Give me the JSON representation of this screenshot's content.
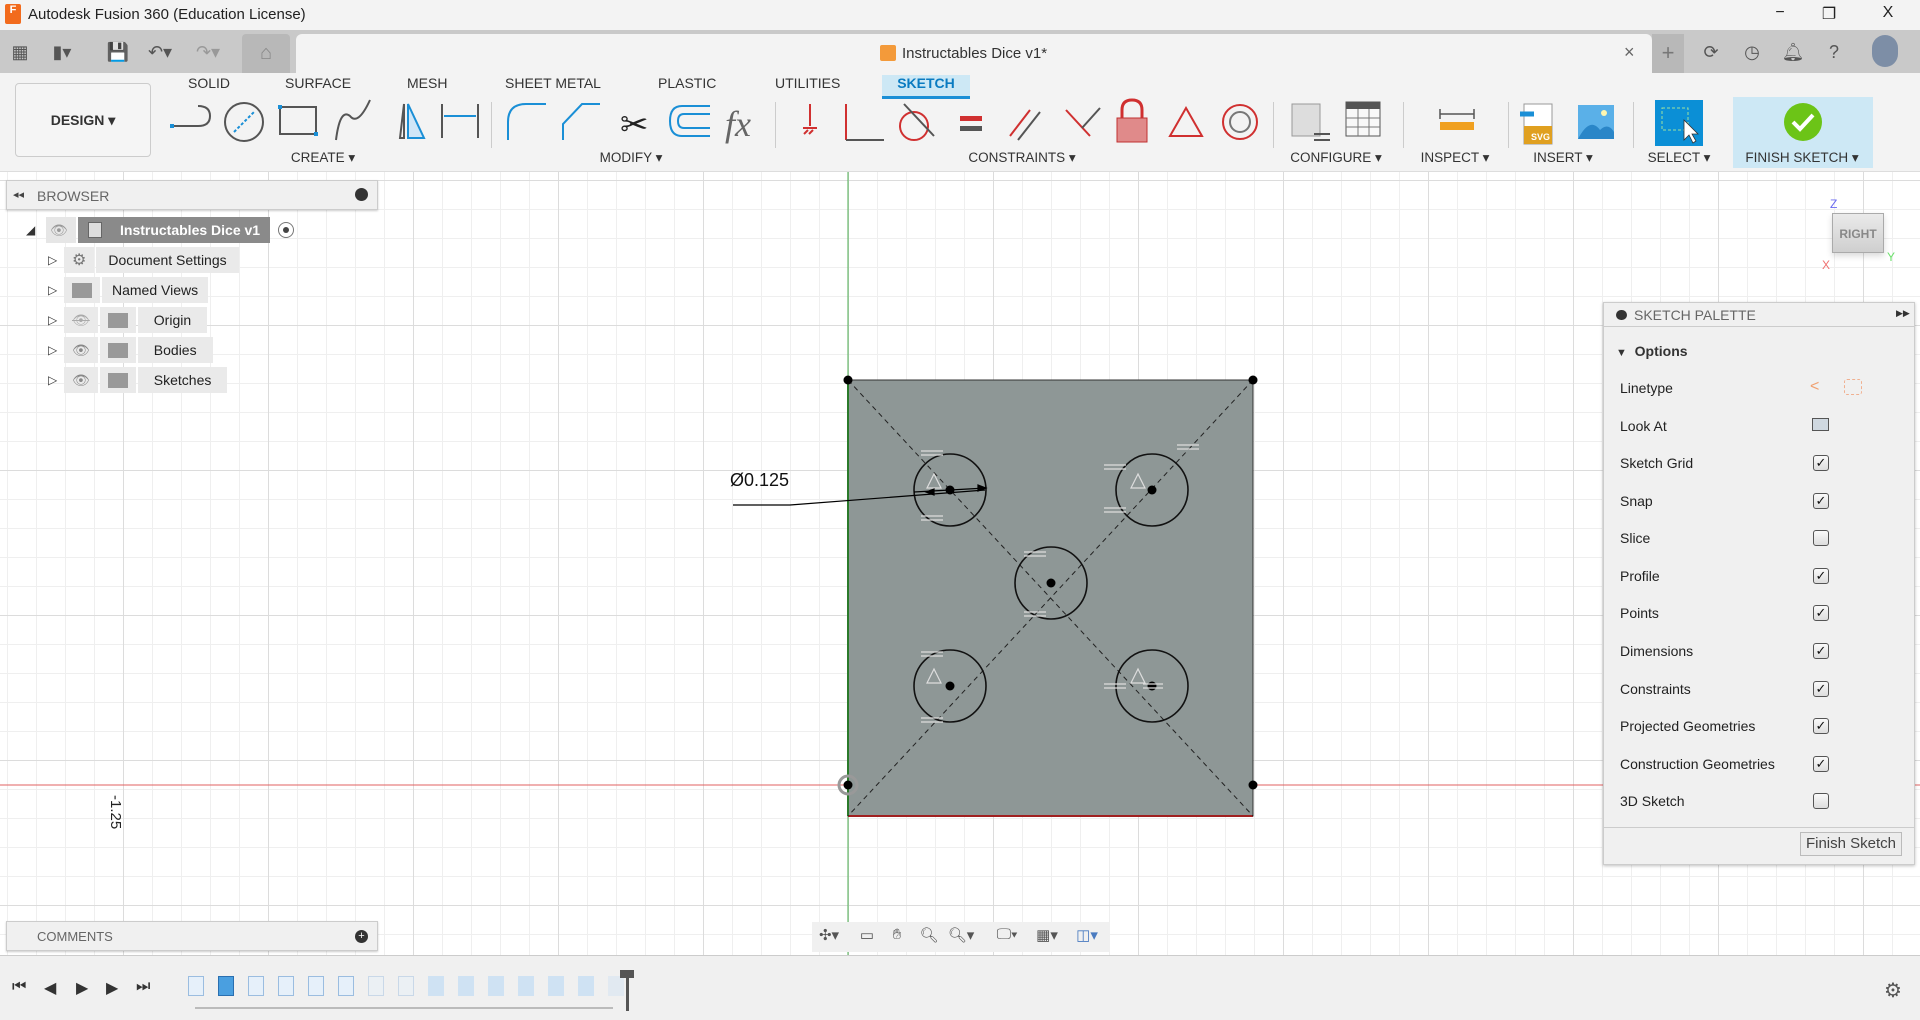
{
  "app": {
    "title": "Autodesk Fusion 360 (Education License)",
    "doc_tab": "Instructables Dice v1*"
  },
  "window_controls": {
    "minimize": "−",
    "restore": "❐",
    "close": "X"
  },
  "workspace": {
    "design_label": "DESIGN ▾"
  },
  "tabs": [
    {
      "label": "SOLID"
    },
    {
      "label": "SURFACE"
    },
    {
      "label": "MESH"
    },
    {
      "label": "SHEET METAL"
    },
    {
      "label": "PLASTIC"
    },
    {
      "label": "UTILITIES"
    },
    {
      "label": "SKETCH",
      "active": true
    }
  ],
  "groups": {
    "create": "CREATE ▾",
    "modify": "MODIFY ▾",
    "constraints": "CONSTRAINTS ▾",
    "configure": "CONFIGURE ▾",
    "inspect": "INSPECT ▾",
    "insert": "INSERT ▾",
    "select": "SELECT ▾",
    "finish": "FINISH SKETCH ▾"
  },
  "browser": {
    "title": "BROWSER",
    "root": "Instructables Dice v1",
    "items": [
      {
        "label": "Document Settings",
        "icon": "gear-icon"
      },
      {
        "label": "Named Views",
        "icon": "folder-icon"
      },
      {
        "label": "Origin",
        "icon": "folder-icon",
        "hidden": true
      },
      {
        "label": "Bodies",
        "icon": "folder-icon"
      },
      {
        "label": "Sketches",
        "icon": "folder-icon"
      }
    ]
  },
  "comments": {
    "title": "COMMENTS"
  },
  "viewcube": {
    "face": "RIGHT",
    "axis_z": "Z",
    "axis_y": "Y",
    "axis_x": "X"
  },
  "sketch": {
    "dimension": "Ø0.125",
    "axis_label": "-1.25"
  },
  "palette": {
    "title": "SKETCH PALETTE",
    "section": "Options",
    "linetype": "Linetype",
    "look_at": "Look At",
    "options": [
      {
        "label": "Sketch Grid",
        "checked": true
      },
      {
        "label": "Snap",
        "checked": true
      },
      {
        "label": "Slice",
        "checked": false
      },
      {
        "label": "Profile",
        "checked": true
      },
      {
        "label": "Points",
        "checked": true
      },
      {
        "label": "Dimensions",
        "checked": true
      },
      {
        "label": "Constraints",
        "checked": true
      },
      {
        "label": "Projected Geometries",
        "checked": true
      },
      {
        "label": "Construction Geometries",
        "checked": true
      },
      {
        "label": "3D Sketch",
        "checked": false
      }
    ],
    "finish_button": "Finish Sketch"
  },
  "colors": {
    "accent": "#0a7bc1",
    "finish_bg": "#cde8f5",
    "profile_fill": "#8e9796",
    "x_axis": "#e06060",
    "y_axis": "#4caf50"
  }
}
